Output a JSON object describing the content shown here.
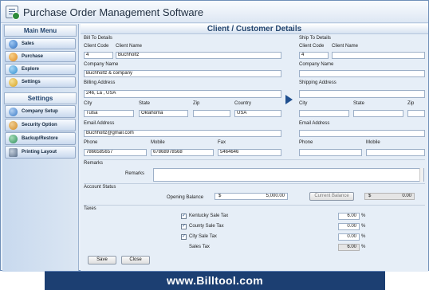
{
  "app": {
    "title": "Purchase Order Management Software"
  },
  "sidebar": {
    "main_menu_title": "Main Menu",
    "main_items": [
      {
        "label": "Sales",
        "icon": "sales-icon",
        "color": "#2f6fc0"
      },
      {
        "label": "Purchase",
        "icon": "purchase-icon",
        "color": "#e08a1e"
      },
      {
        "label": "Explore",
        "icon": "explore-icon",
        "color": "#2f8fd0"
      },
      {
        "label": "Settings",
        "icon": "settings-icon",
        "color": "#d7a21e"
      }
    ],
    "settings_title": "Settings",
    "settings_items": [
      {
        "label": "Company Setup",
        "icon": "company-setup-icon",
        "color": "#3a7bc8"
      },
      {
        "label": "Security Option",
        "icon": "security-icon",
        "color": "#d18b24"
      },
      {
        "label": "Backup/Restore",
        "icon": "backup-restore-icon",
        "color": "#2f8f5a"
      },
      {
        "label": "Printing Layout",
        "icon": "printer-icon",
        "color": "#5a6f8a"
      }
    ]
  },
  "panel": {
    "title": "Client / Customer Details"
  },
  "bill_to": {
    "heading": "Bill To Details",
    "client_code_label": "Client Code",
    "client_name_label": "Client Name",
    "client_code": "4",
    "client_name": "Buchholtz",
    "company_name_label": "Company Name",
    "company_name": "Buchholtz & company",
    "billing_address_label": "Billing Address",
    "billing_address": "246, La , USA",
    "city_label": "City",
    "state_label": "State",
    "zip_label": "Zip",
    "country_label": "Country",
    "city": "Tulsa",
    "state": "Oklahoma",
    "zip": "",
    "country": "USA",
    "email_label": "Email Address",
    "email": "Buchholtz@gmail.com",
    "phone_label": "Phone",
    "mobile_label": "Mobile",
    "fax_label": "Fax",
    "phone": "7866585657",
    "mobile": "67868978568",
    "fax": "5464646"
  },
  "ship_to": {
    "heading": "Ship To Details",
    "client_code_label": "Client Code",
    "client_name_label": "Client Name",
    "client_code": "4",
    "client_name": "",
    "company_name_label": "Company Name",
    "company_name": "",
    "shipping_address_label": "Shipping Address",
    "shipping_address": "",
    "city_label": "City",
    "state_label": "State",
    "zip_label": "Zip",
    "city": "",
    "state": "",
    "zip": "",
    "email_label": "Email Address",
    "email": "",
    "phone_label": "Phone",
    "mobile_label": "Mobile",
    "phone": "",
    "mobile": ""
  },
  "remarks": {
    "section_label": "Remarks",
    "field_label": "Remarks",
    "value": ""
  },
  "account_status": {
    "section_label": "Account Status",
    "opening_balance_label": "Opening Balance",
    "currency_symbol": "$",
    "opening_balance": "5,000.00",
    "current_balance_button": "Current Balance",
    "current_balance": "0.00"
  },
  "taxes": {
    "section_label": "Taxes",
    "items": [
      {
        "label": "Kentucky Sale Tax",
        "checked": true,
        "check_mark": "✓",
        "value": "6.00",
        "unit": "%"
      },
      {
        "label": "County Sale Tax",
        "checked": true,
        "check_mark": "✓",
        "value": "0.00",
        "unit": "%"
      },
      {
        "label": "City Sale Tax",
        "checked": true,
        "check_mark": "✓",
        "value": "0.00",
        "unit": "%"
      }
    ],
    "sales_tax_label": "Sales Tax",
    "sales_tax_value": "6.00",
    "sales_tax_unit": "%"
  },
  "actions": {
    "save": "Save",
    "close": "Close"
  },
  "footer": {
    "text": "www.Billtool.com"
  }
}
